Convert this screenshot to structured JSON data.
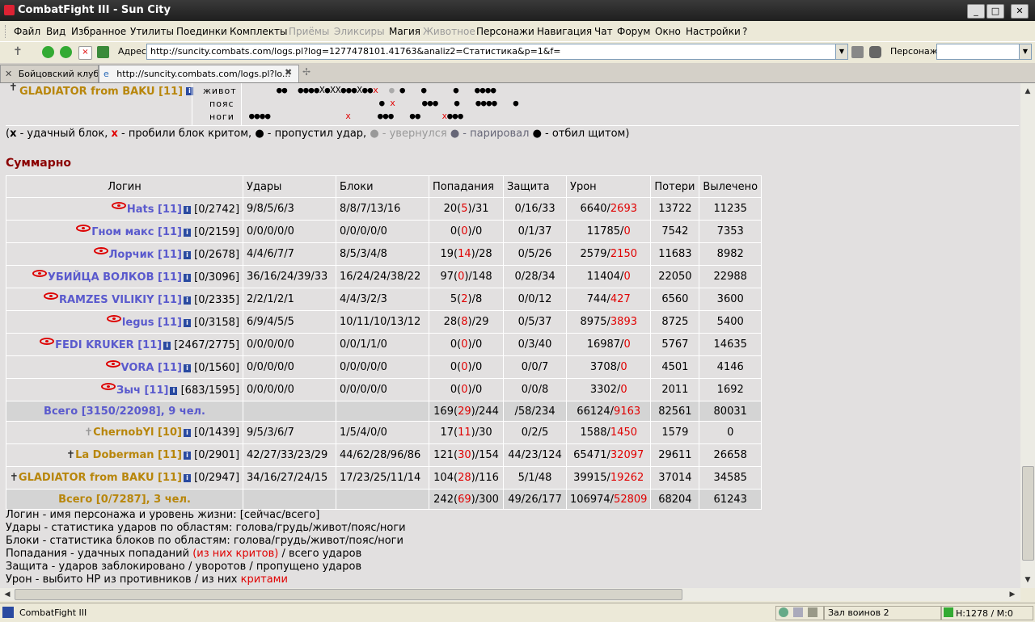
{
  "window": {
    "title": "CombatFight III - Sun City"
  },
  "menu": [
    "Файл",
    "Вид",
    "Избранное",
    "Утилиты",
    "Поединки",
    "Комплекты",
    "Приёмы",
    "Эликсиры",
    "Магия",
    "Животное",
    "Персонажи",
    "Навигация",
    "Чат",
    "Форум",
    "Окно",
    "Настройки",
    "?"
  ],
  "address": {
    "label": "Адрес:",
    "url": "http://suncity.combats.com/logs.pl?log=1277478101.41763&analiz2=Статистика&p=1&f="
  },
  "persona_label": "Персонаж:",
  "tabs": [
    "Бойцовский клуб",
    "http://suncity.combats.com/logs.pl?lo..."
  ],
  "battle": {
    "player": "GLADIATOR from BAKU [11]",
    "parts": [
      "живот",
      "пояс",
      "ноги"
    ]
  },
  "legend_blocks": {
    "x": "x",
    "x_text": " - удачный блок, ",
    "X": "x",
    "X_text": " - пробили блок критом, ",
    "dot_text": "● - пропустил удар, ",
    "grey_text": "● - увернулся ",
    "lb_text": "● - парировал ",
    "dk_text": "● - отбил щитом)"
  },
  "summary_title": "Суммарно",
  "headers": [
    "Логин",
    "Удары",
    "Блоки",
    "Попадания",
    "Защита",
    "Урон",
    "Потери",
    "Вылечено"
  ],
  "team1": [
    {
      "name": "Hats [11]",
      "hp": "[0/2742]",
      "hits": "9/8/5/6/3",
      "blocks": "8/8/7/13/16",
      "p1": "20",
      "p2": "5",
      "p3": "/31",
      "def": "0/16/33",
      "d1": "6640/",
      "d2": "2693",
      "loss": "13722",
      "heal": "11235"
    },
    {
      "name": "Гном макс [11]",
      "hp": "[0/2159]",
      "hits": "0/0/0/0/0",
      "blocks": "0/0/0/0/0",
      "p1": "0",
      "p2": "0",
      "p3": "/0",
      "def": "0/1/37",
      "d1": "11785/",
      "d2": "0",
      "loss": "7542",
      "heal": "7353"
    },
    {
      "name": "Лорчик [11]",
      "hp": "[0/2678]",
      "hits": "4/4/6/7/7",
      "blocks": "8/5/3/4/8",
      "p1": "19",
      "p2": "14",
      "p3": "/28",
      "def": "0/5/26",
      "d1": "2579/",
      "d2": "2150",
      "loss": "11683",
      "heal": "8982"
    },
    {
      "name": "УБИЙЦА ВОЛКОВ [11]",
      "hp": "[0/3096]",
      "hits": "36/16/24/39/33",
      "blocks": "16/24/24/38/22",
      "p1": "97",
      "p2": "0",
      "p3": "/148",
      "def": "0/28/34",
      "d1": "11404/",
      "d2": "0",
      "loss": "22050",
      "heal": "22988"
    },
    {
      "name": "RAMZES VILIKIY [11]",
      "hp": "[0/2335]",
      "hits": "2/2/1/2/1",
      "blocks": "4/4/3/2/3",
      "p1": "5",
      "p2": "2",
      "p3": "/8",
      "def": "0/0/12",
      "d1": "744/",
      "d2": "427",
      "loss": "6560",
      "heal": "3600"
    },
    {
      "name": "legus [11]",
      "hp": "[0/3158]",
      "hits": "6/9/4/5/5",
      "blocks": "10/11/10/13/12",
      "p1": "28",
      "p2": "8",
      "p3": "/29",
      "def": "0/5/37",
      "d1": "8975/",
      "d2": "3893",
      "loss": "8725",
      "heal": "5400"
    },
    {
      "name": "FEDI KRUKER [11]",
      "hp": "[2467/2775]",
      "hits": "0/0/0/0/0",
      "blocks": "0/0/1/1/0",
      "p1": "0",
      "p2": "0",
      "p3": "/0",
      "def": "0/3/40",
      "d1": "16987/",
      "d2": "0",
      "loss": "5767",
      "heal": "14635"
    },
    {
      "name": "VORA [11]",
      "hp": "[0/1560]",
      "hits": "0/0/0/0/0",
      "blocks": "0/0/0/0/0",
      "p1": "0",
      "p2": "0",
      "p3": "/0",
      "def": "0/0/7",
      "d1": "3708/",
      "d2": "0",
      "loss": "4501",
      "heal": "4146"
    },
    {
      "name": "Зыч [11]",
      "hp": "[683/1595]",
      "hits": "0/0/0/0/0",
      "blocks": "0/0/0/0/0",
      "p1": "0",
      "p2": "0",
      "p3": "/0",
      "def": "0/0/8",
      "d1": "3302/",
      "d2": "0",
      "loss": "2011",
      "heal": "1692"
    }
  ],
  "total1": {
    "label": "Всего [3150/22098], 9 чел.",
    "p1": "169",
    "p2": "29",
    "p3": "/244",
    "def": "/58/234",
    "d1": "66124/",
    "d2": "9163",
    "loss": "82561",
    "heal": "80031"
  },
  "team2": [
    {
      "name": "ChernobYl [10]",
      "hp": "[0/1439]",
      "hits": "9/5/3/6/7",
      "blocks": "1/5/4/0/0",
      "p1": "17",
      "p2": "11",
      "p3": "/30",
      "def": "0/2/5",
      "d1": "1588/",
      "d2": "1450",
      "loss": "1579",
      "heal": "0"
    },
    {
      "name": "La Doberman [11]",
      "hp": "[0/2901]",
      "hits": "42/27/33/23/29",
      "blocks": "44/62/28/96/86",
      "p1": "121",
      "p2": "30",
      "p3": "/154",
      "def": "44/23/124",
      "d1": "65471/",
      "d2": "32097",
      "loss": "29611",
      "heal": "26658"
    },
    {
      "name": "GLADIATOR from BAKU [11]",
      "hp": "[0/2947]",
      "hits": "34/16/27/24/15",
      "blocks": "17/23/25/11/14",
      "p1": "104",
      "p2": "28",
      "p3": "/116",
      "def": "5/1/48",
      "d1": "39915/",
      "d2": "19262",
      "loss": "37014",
      "heal": "34585"
    }
  ],
  "total2": {
    "label": "Всего [0/7287], 3 чел.",
    "p1": "242",
    "p2": "69",
    "p3": "/300",
    "def": "49/26/177",
    "d1": "106974/",
    "d2": "52809",
    "loss": "68204",
    "heal": "61243"
  },
  "legend": [
    {
      "a": "Логин - имя персонажа и уровень жизни: [сейчас/всего]",
      "r": "",
      "b": ""
    },
    {
      "a": "Удары - статистика ударов по областям: голова/грудь/живот/пояс/ноги",
      "r": "",
      "b": ""
    },
    {
      "a": "Блоки - статистика блоков по областям: голова/грудь/живот/пояс/ноги",
      "r": "",
      "b": ""
    },
    {
      "a": "Попадания - удачных попаданий ",
      "r": "(из них критов)",
      "b": " / всего ударов"
    },
    {
      "a": "Защита - ударов заблокировано / уворотов / пропущено ударов",
      "r": "",
      "b": ""
    },
    {
      "a": "Урон - выбито HP из противников / из них ",
      "r": "критами",
      "b": ""
    }
  ],
  "status": {
    "app": "CombatFight III",
    "room": "Зал воинов 2",
    "hp": "H:1278 / M:0"
  },
  "colors": {
    "team1": "#5a5acd",
    "team2": "#b8860b",
    "crit": "#e00000"
  }
}
